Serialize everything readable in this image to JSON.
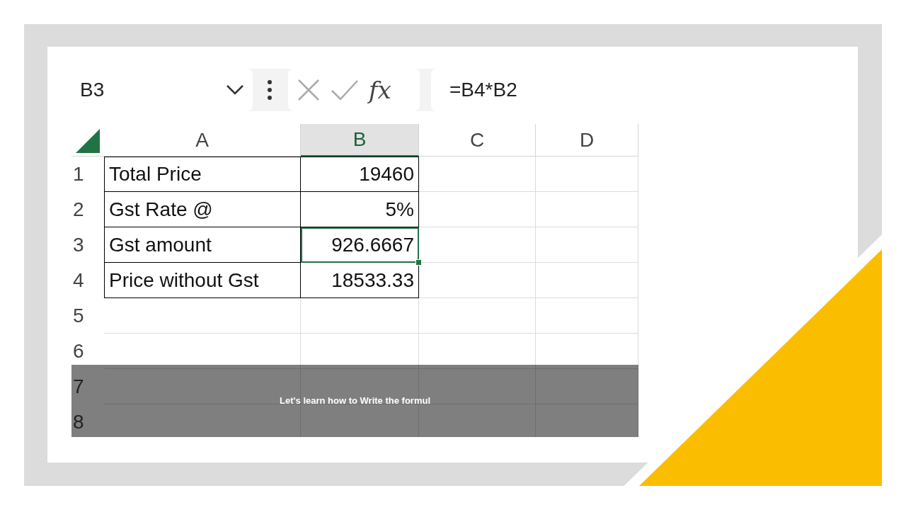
{
  "formula_bar": {
    "name_box": "B3",
    "fx": "fx",
    "formula": "=B4*B2"
  },
  "columns": [
    {
      "label": "A",
      "selected": false
    },
    {
      "label": "B",
      "selected": true
    },
    {
      "label": "C",
      "selected": false
    },
    {
      "label": "D",
      "selected": false
    }
  ],
  "rows": [
    {
      "number": "1",
      "cells": [
        {
          "text": "Total Price",
          "kind": "text",
          "selected": false
        },
        {
          "text": "19460",
          "kind": "number",
          "selected": false
        }
      ]
    },
    {
      "number": "2",
      "cells": [
        {
          "text": "Gst Rate @",
          "kind": "text",
          "selected": false
        },
        {
          "text": "5%",
          "kind": "number",
          "selected": false
        }
      ]
    },
    {
      "number": "3",
      "cells": [
        {
          "text": "Gst amount",
          "kind": "text",
          "selected": false
        },
        {
          "text": "926.6667",
          "kind": "number",
          "selected": true
        }
      ]
    },
    {
      "number": "4",
      "cells": [
        {
          "text": "Price without Gst",
          "kind": "text",
          "selected": false
        },
        {
          "text": "18533.33",
          "kind": "number",
          "selected": false
        }
      ]
    },
    {
      "number": "5",
      "cells": []
    },
    {
      "number": "6",
      "cells": []
    },
    {
      "number": "7",
      "cells": []
    },
    {
      "number": "8",
      "cells": []
    }
  ],
  "caption": "Let's learn how to Write the formul"
}
